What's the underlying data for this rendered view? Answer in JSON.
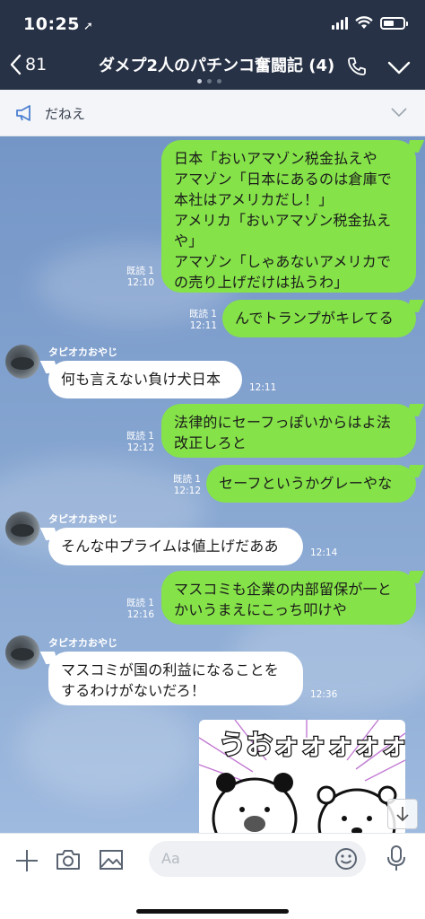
{
  "status": {
    "time": "10:25"
  },
  "header": {
    "back_count": "81",
    "title": "ダメプ2人のパチンコ奮闘記 (4)"
  },
  "announcement": {
    "text": "だねえ"
  },
  "messages": [
    {
      "side": "me",
      "lines": [
        "日本「おいアマゾン税金払えや",
        "アマゾン「日本にあるのは倉庫で",
        "本社はアメリカだし！」",
        "アメリカ「おいアマゾン税金払え",
        "や」",
        "アマゾン「しゃあないアメリカで",
        "の売り上げだけは払うわ」"
      ],
      "read": "既読 1",
      "time": "12:10"
    },
    {
      "side": "me",
      "lines": [
        "んでトランプがキレてる"
      ],
      "read": "既読 1",
      "time": "12:11"
    },
    {
      "side": "them",
      "sender": "タピオカおやじ",
      "lines": [
        "何も言えない負け犬日本"
      ],
      "time": "12:11"
    },
    {
      "side": "me",
      "lines": [
        "法律的にセーフっぽいからはよ法",
        "改正しろと"
      ],
      "read": "既読 1",
      "time": "12:12"
    },
    {
      "side": "me",
      "lines": [
        "セーフというかグレーやな"
      ],
      "read": "既読 1",
      "time": "12:12"
    },
    {
      "side": "them",
      "sender": "タピオカおやじ",
      "lines": [
        "そんな中プライムは値上げだああ"
      ],
      "time": "12:14"
    },
    {
      "side": "me",
      "lines": [
        "マスコミも企業の内部留保が一と",
        "かいうまえにこっち叩けや"
      ],
      "read": "既読 1",
      "time": "12:16"
    },
    {
      "side": "them",
      "sender": "タピオカおやじ",
      "lines": [
        "マスコミが国の利益になることを",
        "するわけがないだろ！"
      ],
      "time": "12:36"
    }
  ],
  "sticker": {
    "text": "うおォォォォォォ"
  },
  "input": {
    "placeholder": "Aa"
  },
  "colors": {
    "header_bg": "#273246",
    "my_bubble": "#85e249",
    "their_bubble": "#ffffff"
  }
}
